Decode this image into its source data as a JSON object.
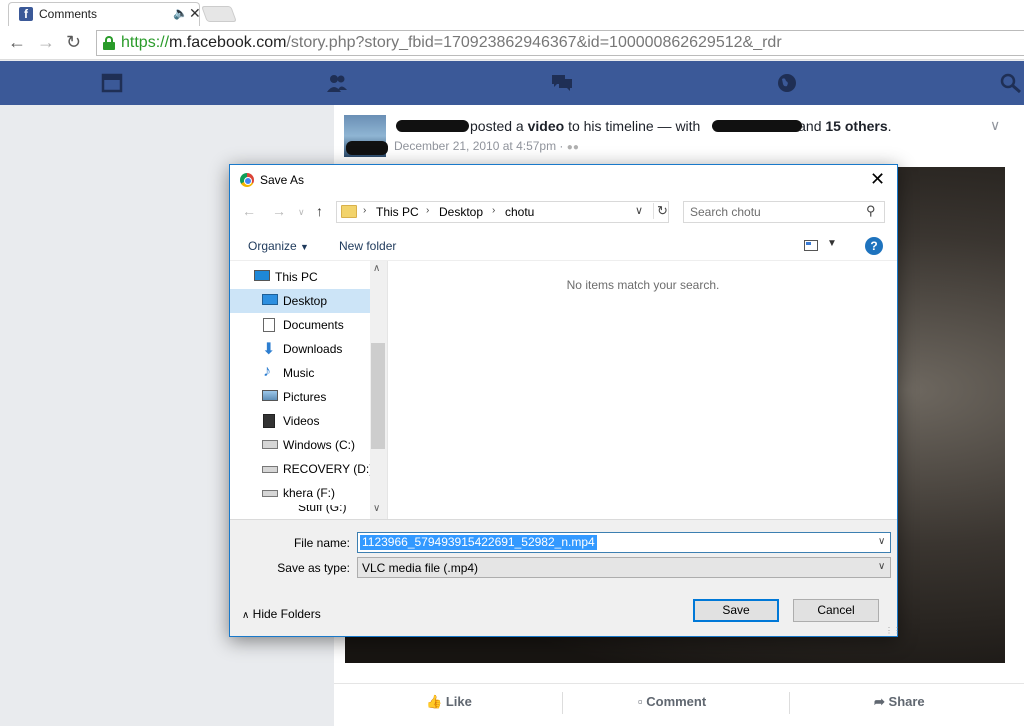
{
  "browser": {
    "tab_title": "Comments",
    "url_scheme": "https://",
    "url_host": "m.facebook.com",
    "url_rest": "/story.php?story_fbid=170923862946367&id=100000862629512&_rdr"
  },
  "post": {
    "verb": "posted a",
    "object": "video",
    "target": "to his timeline — with",
    "and_text": "and",
    "others": "15 others",
    "period": ".",
    "date": "December 21, 2010 at 4:57pm ·",
    "actions": {
      "like": "Like",
      "comment": "Comment",
      "share": "Share"
    }
  },
  "dialog": {
    "title": "Save As",
    "breadcrumb": [
      "This PC",
      "Desktop",
      "chotu"
    ],
    "search_placeholder": "Search chotu",
    "organize": "Organize",
    "new_folder": "New folder",
    "nav_items": [
      "This PC",
      "Desktop",
      "Documents",
      "Downloads",
      "Music",
      "Pictures",
      "Videos",
      "Windows (C:)",
      "RECOVERY (D:)",
      "khera (F:)",
      "Stuff (G:)"
    ],
    "selected_nav": "Desktop",
    "empty_message": "No items match your search.",
    "file_name_label": "File name:",
    "file_name": "1123966_579493915422691_52982_n.mp4",
    "save_type_label": "Save as type:",
    "save_type": "VLC media file (.mp4)",
    "hide_folders": "Hide Folders",
    "save": "Save",
    "cancel": "Cancel"
  },
  "colors": {
    "facebook_blue": "#3b5998",
    "dialog_accent": "#1979ca",
    "selection": "#3399ff"
  }
}
